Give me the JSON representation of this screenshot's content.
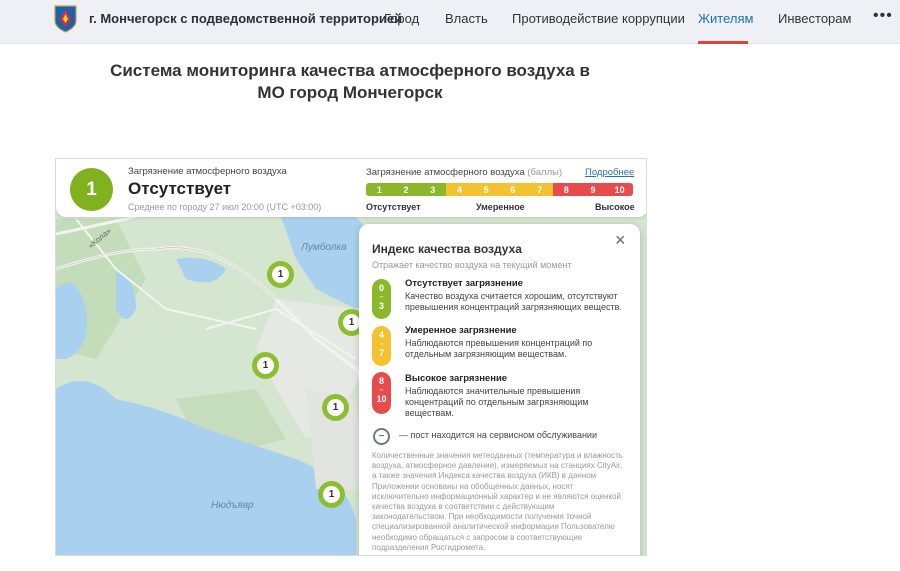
{
  "header": {
    "site_title": "г. Мончегорск с подведомственной территорией",
    "nav": [
      {
        "label": "Город",
        "active": false
      },
      {
        "label": "Власть",
        "active": false
      },
      {
        "label": "Противодействие коррупции",
        "active": false
      },
      {
        "label": "Жителям",
        "active": true
      },
      {
        "label": "Инвесторам",
        "active": false
      }
    ],
    "more_label": "•••"
  },
  "page_title": "Система мониторинга качества атмосферного воздуха в МО город Мончегорск",
  "widget": {
    "aqi_value": "1",
    "label": "Загрязнение атмосферного воздуха",
    "status": "Отсутствует",
    "subtitle": "Среднее по городу 27 июл 20:00 (UTC +03:00)",
    "scale_title": "Загрязнение атмосферного воздуха",
    "scale_units": "(баллы)",
    "more_link": "Подробнее",
    "scale": [
      {
        "v": "1",
        "color": "#8ab82a"
      },
      {
        "v": "2",
        "color": "#8ab82a"
      },
      {
        "v": "3",
        "color": "#8ab82a"
      },
      {
        "v": "4",
        "color": "#f2c230"
      },
      {
        "v": "5",
        "color": "#f2c230"
      },
      {
        "v": "6",
        "color": "#f2c230"
      },
      {
        "v": "7",
        "color": "#f2c230"
      },
      {
        "v": "8",
        "color": "#e74b4b"
      },
      {
        "v": "9",
        "color": "#e74b4b"
      },
      {
        "v": "10",
        "color": "#e74b4b"
      }
    ],
    "scale_labels": {
      "low": "Отсутствует",
      "mid": "Умеренное",
      "high": "Высокое"
    }
  },
  "map": {
    "place_labels": [
      "Лумболка",
      "Нюдъявр",
      "«Кола»"
    ],
    "markers": [
      "1",
      "1",
      "1",
      "1",
      "1"
    ]
  },
  "popup": {
    "title": "Индекс качества воздуха",
    "subtitle": "Отражает качество воздуха на текущий момент",
    "close_icon": "×",
    "legend": [
      {
        "range_from": "0",
        "range_to": "3",
        "color": "#8ab82a",
        "title": "Отсутствует загрязнение",
        "text": "Качество воздуха считается хорошим, отсутствуют превышения концентраций загрязняющих веществ."
      },
      {
        "range_from": "4",
        "range_to": "7",
        "color": "#f2c230",
        "title": "Умеренное загрязнение",
        "text": "Наблюдаются превышения концентраций по отдельным загрязняющим веществам."
      },
      {
        "range_from": "8",
        "range_to": "10",
        "color": "#e74b4b",
        "title": "Высокое загрязнение",
        "text": "Наблюдаются значительные превышения концентраций по отдельным загрязняющим веществам."
      }
    ],
    "service_icon": "−",
    "service_text": "— пост находится на сервисном обслуживании",
    "disclaimer": "Количественные значения метеоданных (температура и влажность воздуха, атмосферное давление), измеряемых на станциях CityAir, а также значения Индекса качества воздуха (ИКВ) в данном Приложении основаны на обобщенных данных, носят исключительно информационный характер и не являются оценкой качества воздуха в соответствии с действующим законодательством. При необходимости получения точной специализированной аналитической информации Пользователю необходимо обращаться с запросом в соответствующие подразделения Росгидромета."
  }
}
